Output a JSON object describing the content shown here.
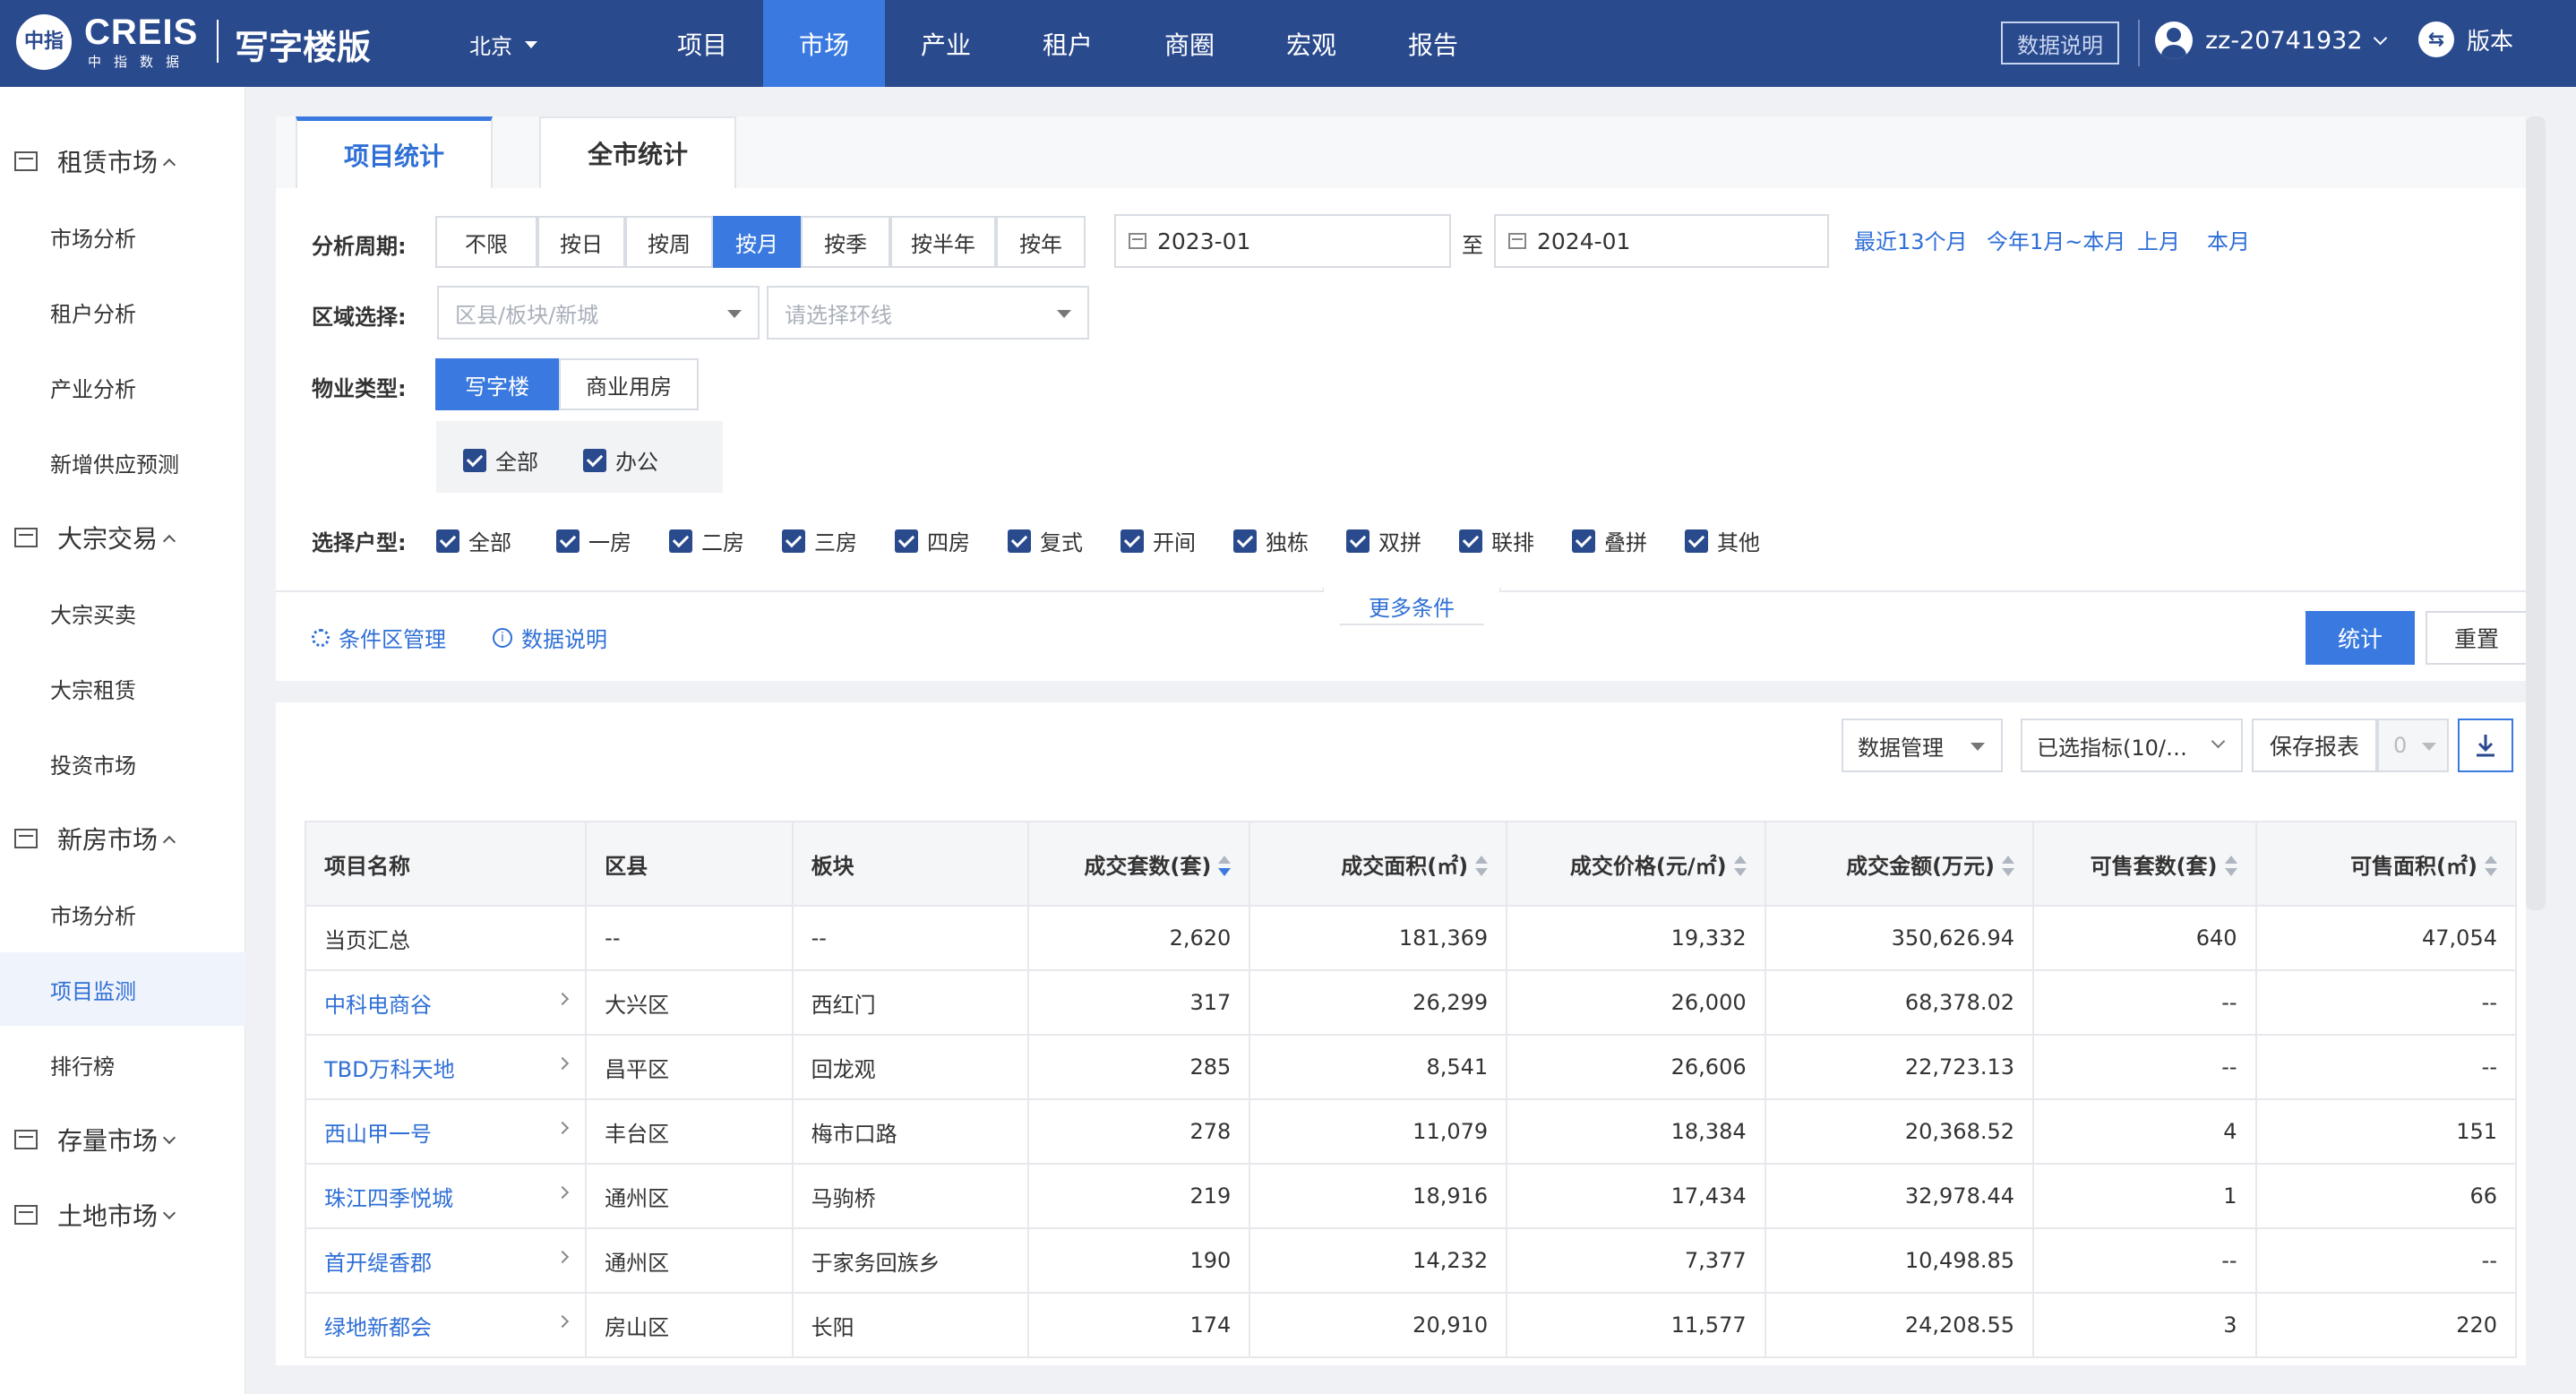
{
  "header": {
    "logo_mark": "中指",
    "logo_text": "CREIS",
    "logo_sub": "中指数据",
    "product": "写字楼版",
    "city": "北京",
    "nav": [
      "项目",
      "市场",
      "产业",
      "租户",
      "商圈",
      "宏观",
      "报告"
    ],
    "active_nav": "市场",
    "data_explain": "数据说明",
    "user": "zz-20741932",
    "version_label": "版本"
  },
  "sidebar": {
    "groups": [
      {
        "label": "租赁市场",
        "items": [
          "市场分析",
          "租户分析",
          "产业分析",
          "新增供应预测"
        ]
      },
      {
        "label": "大宗交易",
        "items": [
          "大宗买卖",
          "大宗租赁",
          "投资市场"
        ]
      },
      {
        "label": "新房市场",
        "items": [
          "市场分析",
          "项目监测",
          "排行榜"
        ]
      },
      {
        "label": "存量市场",
        "items": []
      },
      {
        "label": "土地市场",
        "items": []
      }
    ],
    "active_item": "项目监测"
  },
  "tabs": [
    "项目统计",
    "全市统计"
  ],
  "filters": {
    "period_label": "分析周期:",
    "period_options": [
      "不限",
      "按日",
      "按周",
      "按月",
      "按季",
      "按半年",
      "按年"
    ],
    "period_active": "按月",
    "date_from": "2023-01",
    "date_sep": "至",
    "date_to": "2024-01",
    "quick_ranges": [
      "最近13个月",
      "今年1月~本月",
      "上月",
      "本月"
    ],
    "region_label": "区域选择:",
    "region_placeholder": "区县/板块/新城",
    "ring_placeholder": "请选择环线",
    "property_label": "物业类型:",
    "property_options": [
      "写字楼",
      "商业用房"
    ],
    "property_active": "写字楼",
    "property_subtypes": [
      "全部",
      "办公"
    ],
    "unit_label": "选择户型:",
    "unit_types": [
      "全部",
      "一房",
      "二房",
      "三房",
      "四房",
      "复式",
      "开间",
      "独栋",
      "双拼",
      "联排",
      "叠拼",
      "其他"
    ],
    "more": "更多条件",
    "condition_mgmt": "条件区管理",
    "data_explain": "数据说明",
    "stat_btn": "统计",
    "reset_btn": "重置"
  },
  "toolbar": {
    "data_mgmt": "数据管理",
    "selected_metrics": "已选指标(10/…",
    "save_report": "保存报表",
    "report_count": "0"
  },
  "table": {
    "columns": [
      "项目名称",
      "区县",
      "板块",
      "成交套数(套)",
      "成交面积(㎡)",
      "成交价格(元/㎡)",
      "成交金额(万元)",
      "可售套数(套)",
      "可售面积(㎡)"
    ],
    "summary": [
      "当页汇总",
      "--",
      "--",
      "2,620",
      "181,369",
      "19,332",
      "350,626.94",
      "640",
      "47,054"
    ],
    "rows": [
      [
        "中科电商谷",
        "大兴区",
        "西红门",
        "317",
        "26,299",
        "26,000",
        "68,378.02",
        "--",
        "--"
      ],
      [
        "TBD万科天地",
        "昌平区",
        "回龙观",
        "285",
        "8,541",
        "26,606",
        "22,723.13",
        "--",
        "--"
      ],
      [
        "西山甲一号",
        "丰台区",
        "梅市口路",
        "278",
        "11,079",
        "18,384",
        "20,368.52",
        "4",
        "151"
      ],
      [
        "珠江四季悦城",
        "通州区",
        "马驹桥",
        "219",
        "18,916",
        "17,434",
        "32,978.44",
        "1",
        "66"
      ],
      [
        "首开缇香郡",
        "通州区",
        "于家务回族乡",
        "190",
        "14,232",
        "7,377",
        "10,498.85",
        "--",
        "--"
      ],
      [
        "绿地新都会",
        "房山区",
        "长阳",
        "174",
        "20,910",
        "11,577",
        "24,208.55",
        "3",
        "220"
      ]
    ]
  },
  "colors": {
    "header_bg": "#2a4a8e",
    "accent": "#3a7ae0",
    "link": "#2f6fd6"
  }
}
